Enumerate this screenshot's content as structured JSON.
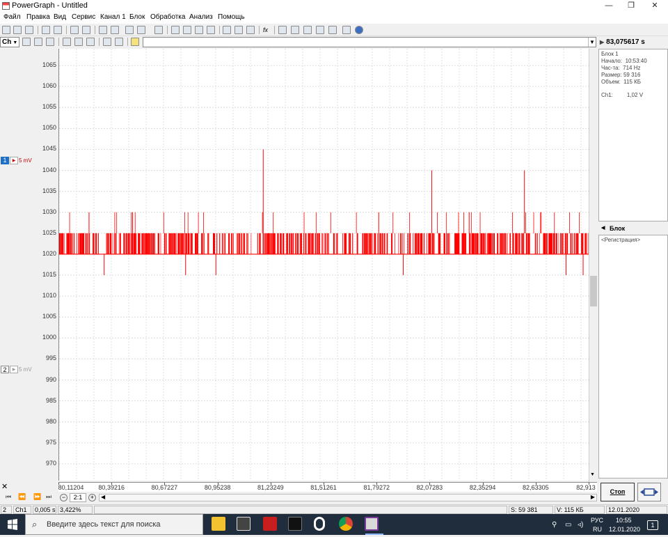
{
  "window": {
    "title": "PowerGraph - Untitled",
    "controls": {
      "minimize": "—",
      "maximize": "❐",
      "close": "✕"
    }
  },
  "menu": [
    "Файл",
    "Правка",
    "Вид",
    "Сервис",
    "Канал 1",
    "Блок",
    "Обработка",
    "Анализ",
    "Помощь"
  ],
  "toolbar2": {
    "channel_select": "Ch",
    "time": "83,075617 s"
  },
  "plot": {
    "y_ticks": [
      "1065",
      "1060",
      "1055",
      "1050",
      "1045",
      "1040",
      "1035",
      "1030",
      "1025",
      "1020",
      "1015",
      "1010",
      "1005",
      "1000",
      "995",
      "990",
      "985",
      "980",
      "975",
      "970"
    ],
    "x_ticks": [
      "80,11204",
      "80,39216",
      "80,67227",
      "80,95238",
      "81,23249",
      "81,51261",
      "81,79272",
      "82,07283",
      "82,35294",
      "82,63305",
      "82,913"
    ],
    "channels": [
      {
        "number": "1",
        "scale": "5 mV",
        "color": "#c00000"
      },
      {
        "number": "2",
        "scale": "5 mV",
        "color": "#999999"
      }
    ],
    "signal_color": "#ff0000"
  },
  "chart_data": {
    "type": "line",
    "y_unit_ticks": [
      970,
      1065
    ],
    "ylim": [
      966,
      1069
    ],
    "xlim": [
      80.11204,
      82.913
    ],
    "baseline_low": 1020,
    "baseline_high": 1025,
    "spikes_up": [
      [
        81.19,
        1045
      ],
      [
        82.08,
        1040
      ],
      [
        82.57,
        1040
      ],
      [
        80.27,
        1030
      ],
      [
        81.8,
        1030
      ],
      [
        80.5,
        1030
      ]
    ],
    "spikes_down": [
      [
        80.35,
        1015
      ],
      [
        80.78,
        1015
      ],
      [
        80.94,
        1015
      ],
      [
        81.93,
        1015
      ],
      [
        82.79,
        1015
      ],
      [
        82.88,
        1015
      ]
    ]
  },
  "right_panel": {
    "rows": [
      {
        "label": "Блок 1",
        "value": ""
      },
      {
        "label": "Начало:",
        "value": "10:53:40"
      },
      {
        "label": "Час-та:",
        "value": "714 Hz"
      },
      {
        "label": "Размер:",
        "value": "59 316"
      },
      {
        "label": "Объем:",
        "value": "115 КБ"
      }
    ],
    "channel": {
      "label": "Ch1:",
      "value": "1,02 V"
    },
    "block_header": "Блок",
    "block_item": "<Регистрация>"
  },
  "bottom": {
    "zoom": "2:1",
    "stop_button": "Стоп"
  },
  "status": {
    "cell1": "2",
    "cell2": "Ch1",
    "cell3": "0,005 s",
    "cell4": "3,422%",
    "samples": "S: 59 381",
    "volume": "V: 115 КБ",
    "date": "12.01.2020"
  },
  "taskbar": {
    "search_placeholder": "Введите здесь текст для поиска",
    "lang_top": "РУС",
    "lang_bottom": "RU",
    "time": "10:55",
    "date": "12.01.2020",
    "notifications": "1"
  }
}
